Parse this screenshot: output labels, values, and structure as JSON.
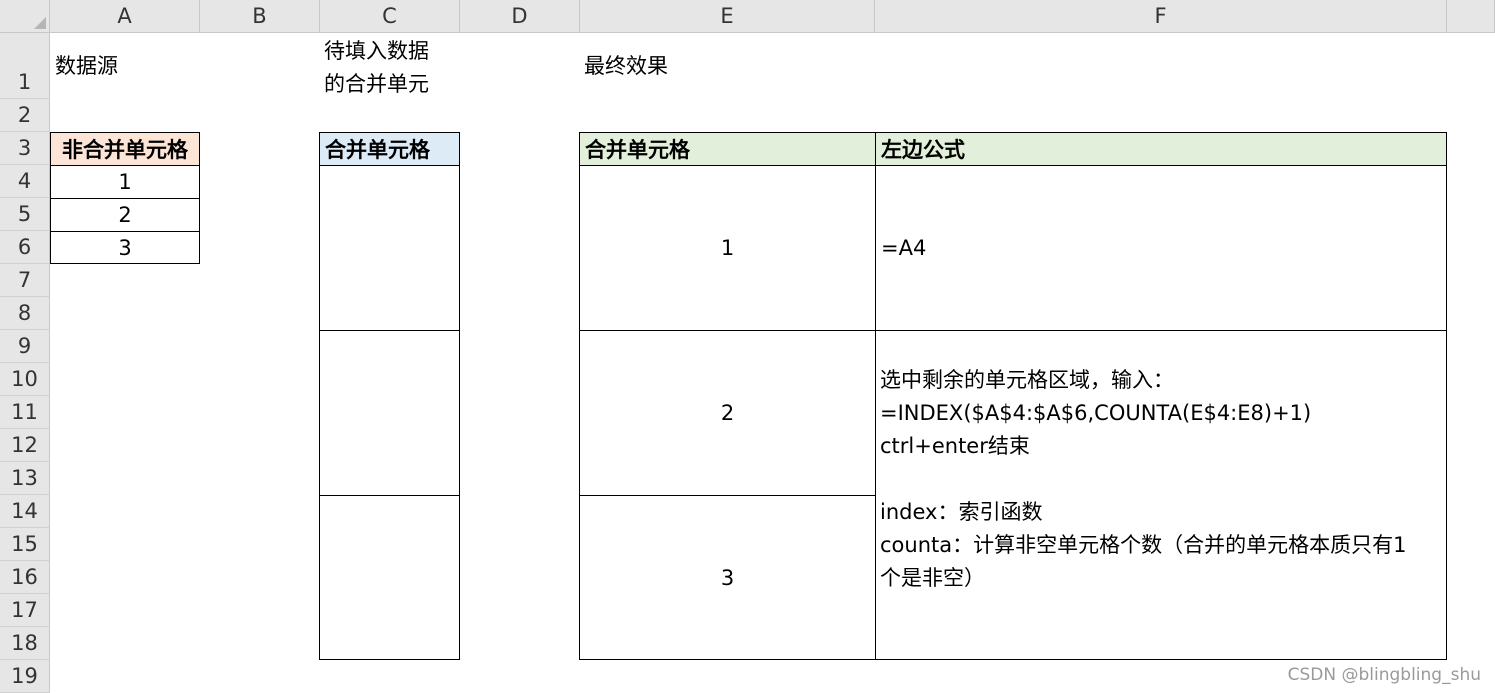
{
  "columns": [
    "A",
    "B",
    "C",
    "D",
    "E",
    "F"
  ],
  "rows": [
    "1",
    "2",
    "3",
    "4",
    "5",
    "6",
    "7",
    "8",
    "9",
    "10",
    "11",
    "12",
    "13",
    "14",
    "15",
    "16",
    "17",
    "18",
    "19"
  ],
  "source": {
    "title": "数据源",
    "header": "非合并单元格",
    "values": [
      "1",
      "2",
      "3"
    ]
  },
  "target": {
    "title_line1": "待填入数据",
    "title_line2": "的合并单元",
    "header": "合并单元格"
  },
  "result": {
    "title": "最终效果",
    "header_merged": "合并单元格",
    "header_formula": "左边公式",
    "values": [
      "1",
      "2",
      "3"
    ],
    "formula_first": "=A4",
    "notes": [
      "选中剩余的单元格区域，输入：",
      "=INDEX($A$4:$A$6,COUNTA(E$4:E8)+1)",
      "ctrl+enter结束",
      "",
      "index：索引函数",
      "counta：计算非空单元格个数（合并的单元格本质只有1",
      "个是非空）"
    ]
  },
  "watermark": "CSDN @blingbling_shu"
}
